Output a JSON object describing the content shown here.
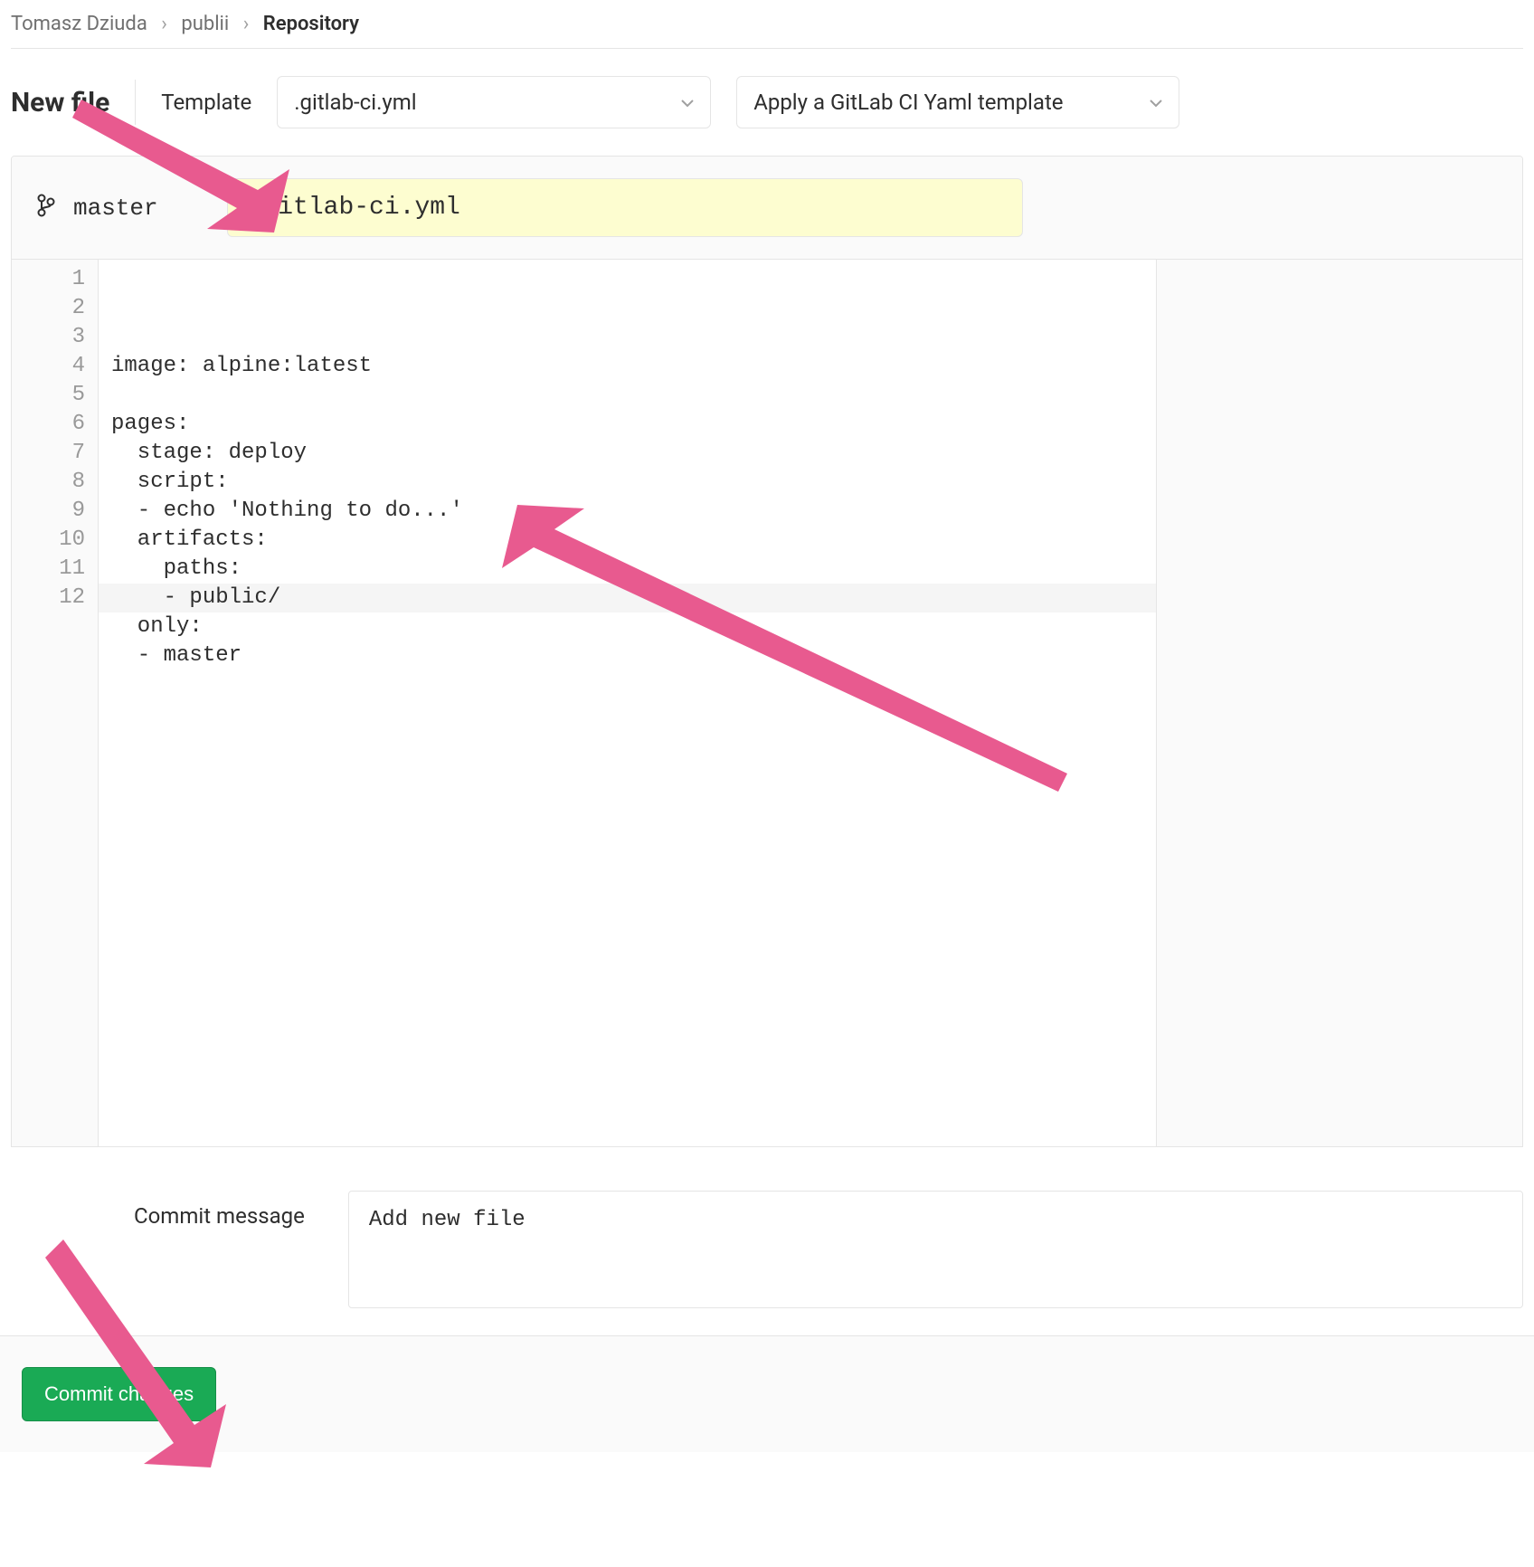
{
  "breadcrumb": {
    "owner": "Tomasz Dziuda",
    "project": "publii",
    "page": "Repository"
  },
  "toolbar": {
    "title": "New file",
    "template_label": "Template",
    "template_value": ".gitlab-ci.yml",
    "apply_template_label": "Apply a GitLab CI Yaml template"
  },
  "editor": {
    "branch": "master",
    "filename": ".gitlab-ci.yml",
    "line_numbers": [
      "1",
      "2",
      "3",
      "4",
      "5",
      "6",
      "7",
      "8",
      "9",
      "10",
      "11",
      "12"
    ],
    "code": "image: alpine:latest\n\npages:\n  stage: deploy\n  script:\n  - echo 'Nothing to do...'\n  artifacts:\n    paths:\n    - public/\n  only:\n  - master\n"
  },
  "commit": {
    "label": "Commit message",
    "message": "Add new file",
    "button": "Commit changes"
  },
  "annotations": {
    "arrow_color": "#e85a8f"
  }
}
